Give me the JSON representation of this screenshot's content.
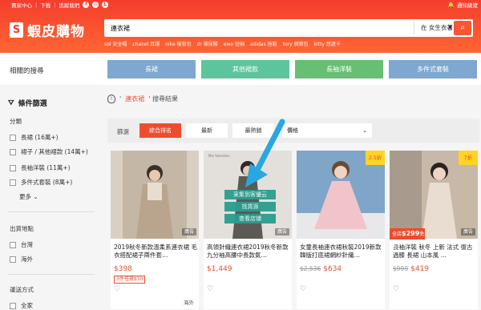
{
  "header": {
    "seller_center": "賣家中心",
    "download": "下載",
    "follow": "追蹤我們",
    "notifications": "通知總覽",
    "logo": "蝦皮購物",
    "search_value": "連衣裙",
    "scope": "在 女生衣著",
    "hints": [
      "sol 安全帽",
      "chanel 耳環",
      "nike 後背包",
      "dr 玻尿酸",
      "ewo 短袖",
      "adidas 拖鞋",
      "tory 側背包",
      "kitty 悠遊卡"
    ]
  },
  "related": {
    "label": "相關的搜尋",
    "items": [
      "長裙",
      "其他裙款",
      "長袖洋裝",
      "多件式套裝"
    ],
    "colors": [
      "#7ea7d1",
      "#5cc59b",
      "#66bf73",
      "#7ea7d1"
    ]
  },
  "filters": {
    "title": "條件篩選",
    "category_label": "分類",
    "categories": [
      "長裙 (16萬+)",
      "裙子 / 其他裙款 (14萬+)",
      "長袖洋裝 (11萬+)",
      "多件式套裝 (8萬+)"
    ],
    "more": "更多",
    "ship_from_label": "出貨地點",
    "ship_from": [
      "台灣",
      "海外"
    ],
    "shipping_label": "運送方式",
    "shipping": [
      "全家"
    ]
  },
  "results": {
    "prefix": "'",
    "keyword": "連衣裙",
    "suffix": "' 搜尋結果"
  },
  "sort": {
    "label": "篩選",
    "options": [
      "綜合排名",
      "最新",
      "最熱銷"
    ],
    "price": "價格"
  },
  "products": [
    {
      "name": "2019秋冬新款溫柔系連衣裙 毛衣搭配裙子兩件套…",
      "price": "$398",
      "tag": "3件任選$30",
      "loc": "海外",
      "ad": "廣告"
    },
    {
      "name": "高領針織連衣裙2019秋冬新款九分袖高腰中長款氣…",
      "price": "$1,449",
      "ad": "廣告",
      "img_label": "Mix Selection",
      "overlay": [
        "采集到客優云",
        "找貨源",
        "查看店铺"
      ]
    },
    {
      "name": "女童長袖連衣裙秋裝2019新款韓版打底裙網紗針織…",
      "old": "$2,536",
      "price": "$634",
      "disc": "2.5折"
    },
    {
      "name": "長袖洋裝 秋冬 上新 法式 復古 過膝 長裙 山本風 …",
      "old": "$999",
      "price": "$419",
      "disc": "7折",
      "ad": "廣告",
      "promo_prefix": "全店",
      "promo_value": "$299",
      "promo_suffix": "免運"
    }
  ],
  "icons": {
    "search": "magnifier-icon",
    "heart": "heart-icon",
    "filter": "funnel-icon",
    "bulb": "lightbulb-icon"
  }
}
